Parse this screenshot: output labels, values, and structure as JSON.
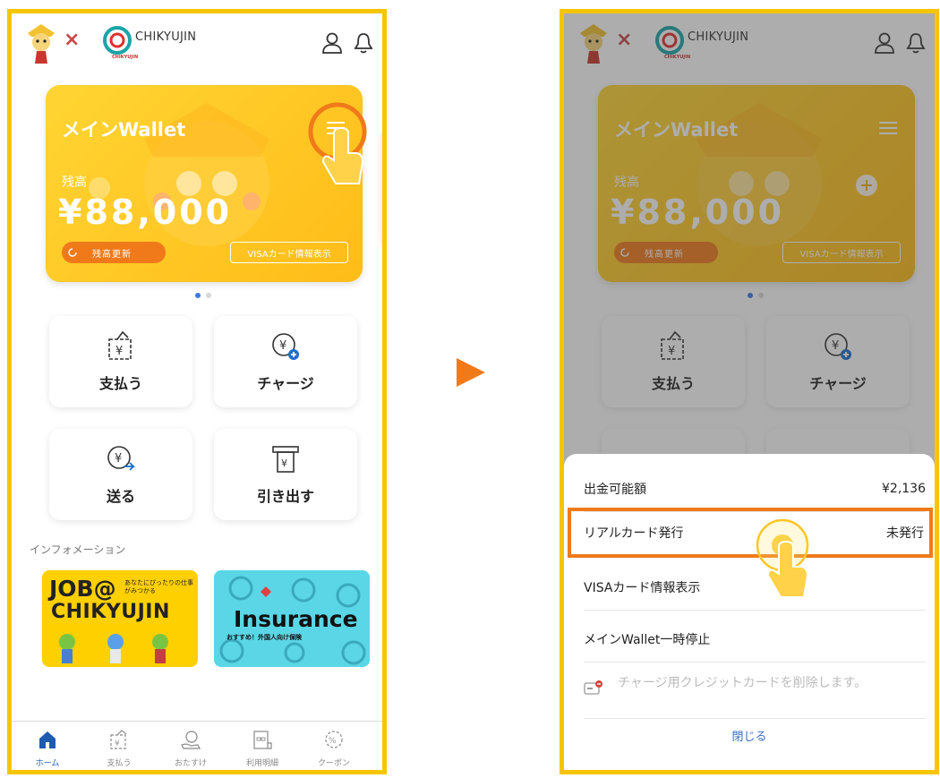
{
  "brand": {
    "partner_name": "CHIKYUJIN",
    "partner_sub": "CHIKYUJIN"
  },
  "wallet": {
    "title": "メインWallet",
    "balance_label": "残高",
    "balance": "¥88,000",
    "refresh_label": "残高更新",
    "visa_label": "VISAカード情報表示"
  },
  "actions": [
    {
      "label": "支払う"
    },
    {
      "label": "チャージ"
    },
    {
      "label": "送る"
    },
    {
      "label": "引き出す"
    }
  ],
  "info": {
    "title": "インフォメーション",
    "banner_job": {
      "line1": "JOB@",
      "line2": "CHIKYUJIN",
      "tagline": "あなたにぴったりの仕事がみつかる"
    },
    "banner_ins": {
      "title": "Insurance",
      "tagline": "おすすめ！外国人向け保険"
    }
  },
  "tabs": [
    {
      "label": "ホーム"
    },
    {
      "label": "支払う"
    },
    {
      "label": "おたすけ"
    },
    {
      "label": "利用明細"
    },
    {
      "label": "クーポン"
    }
  ],
  "sheet": {
    "withdrawable_label": "出金可能額",
    "withdrawable_value": "¥2,136",
    "real_card_label": "リアルカード発行",
    "real_card_status": "未発行",
    "visa_info_label": "VISAカード情報表示",
    "pause_label": "メインWallet一時停止",
    "delete_card_label": "チャージ用クレジットカードを削除します。",
    "close_label": "閉じる"
  },
  "colors": {
    "frame": "#f6c500",
    "card": "#ffc61f",
    "accent_orange": "#f07a1a",
    "tab_active": "#1e5bb0"
  }
}
